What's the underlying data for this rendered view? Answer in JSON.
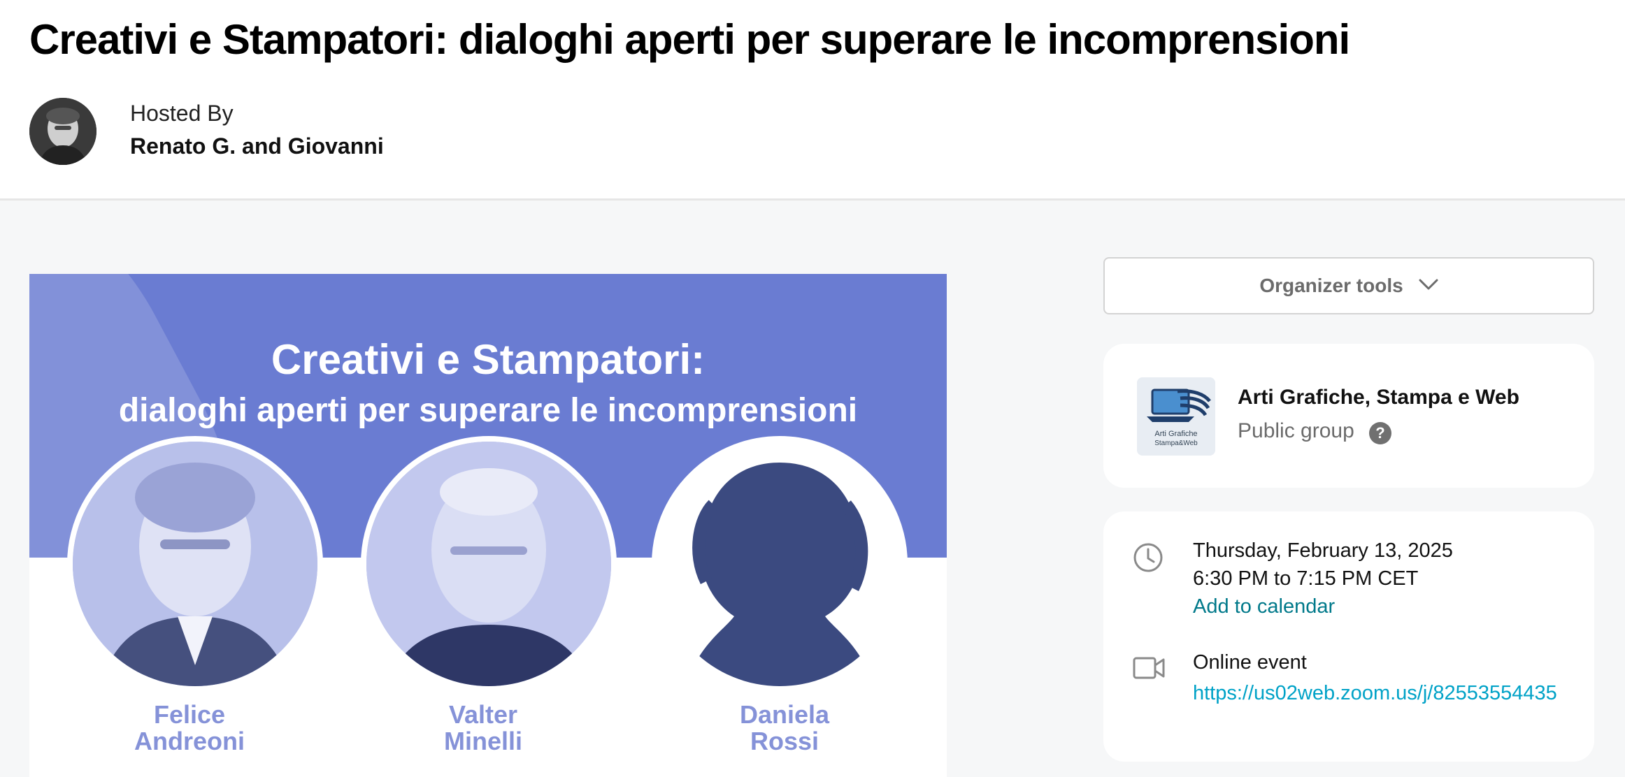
{
  "event": {
    "title": "Creativi e Stampatori: dialoghi aperti per superare le incomprensioni"
  },
  "host": {
    "hosted_by_label": "Hosted By",
    "names": "Renato G. and Giovanni"
  },
  "event_image": {
    "title_line_1": "Creativi e Stampatori:",
    "title_line_2": "dialoghi aperti per superare le incomprensioni",
    "speakers": [
      {
        "first": "Felice",
        "last": "Andreoni"
      },
      {
        "first": "Valter",
        "last": "Minelli"
      },
      {
        "first": "Daniela",
        "last": "Rossi"
      }
    ],
    "band_color": "#6a7cd2",
    "name_color": "#8592d8"
  },
  "sidebar": {
    "organizer_tools_label": "Organizer tools",
    "group": {
      "name": "Arti Grafiche, Stampa e Web",
      "type": "Public group",
      "help_glyph": "?",
      "logo_text_1": "Arti Grafiche",
      "logo_text_2": "Stampa&Web"
    },
    "details": {
      "date": "Thursday, February 13, 2025",
      "time": "6:30 PM to 7:15 PM CET",
      "add_to_calendar": "Add to calendar",
      "location_type": "Online event",
      "link": "https://us02web.zoom.us/j/82553554435"
    }
  },
  "icons": [
    "chevron-down-icon",
    "help-icon",
    "clock-icon",
    "video-camera-icon"
  ],
  "colors": {
    "link": "#00798a",
    "zoom_link": "#00a2c7"
  }
}
